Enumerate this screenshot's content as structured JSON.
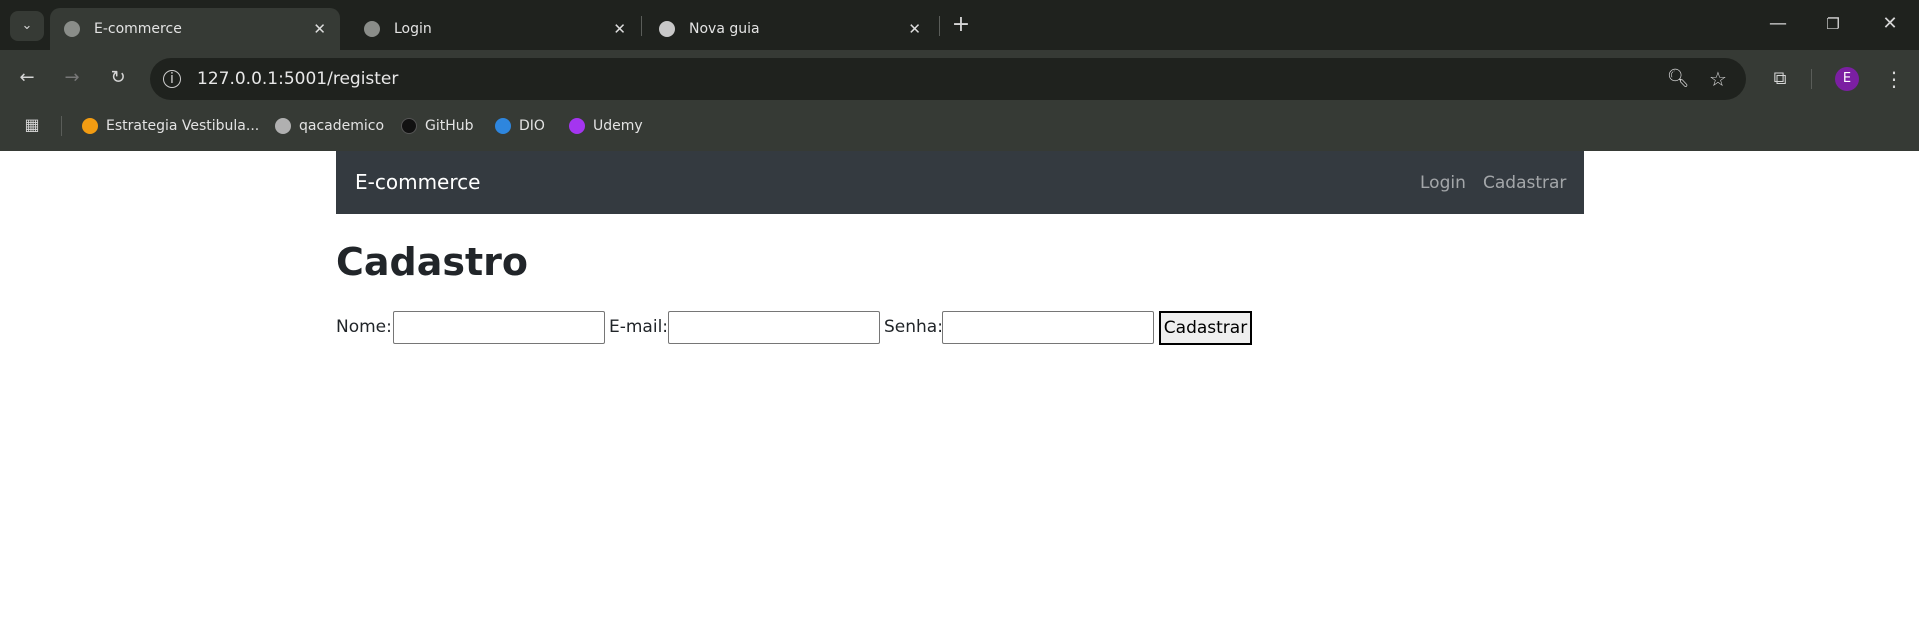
{
  "browser": {
    "tabs": [
      {
        "title": "E-commerce",
        "active": true,
        "icon": "globe-icon"
      },
      {
        "title": "Login",
        "active": false,
        "icon": "globe-icon"
      },
      {
        "title": "Nova guia",
        "active": false,
        "icon": "chrome-icon"
      }
    ],
    "url": "127.0.0.1:5001/register",
    "profile_initial": "E",
    "profile_color": "#7b1fa2",
    "bookmarks": [
      {
        "label": "Estrategia Vestibula...",
        "color": "#f39c12"
      },
      {
        "label": "qacademico",
        "color": "#b0b0b0"
      },
      {
        "label": "GitHub",
        "color": "#111111"
      },
      {
        "label": "DIO",
        "color": "#2e86de"
      },
      {
        "label": "Udemy",
        "color": "#a435f0"
      }
    ]
  },
  "navbar": {
    "brand": "E-commerce",
    "links": [
      "Login",
      "Cadastrar"
    ]
  },
  "page": {
    "title": "Cadastro",
    "form": {
      "name_label": "Nome:",
      "name_value": "",
      "email_label": "E-mail:",
      "email_value": "",
      "password_label": "Senha:",
      "password_value": "",
      "submit_label": "Cadastrar"
    }
  }
}
